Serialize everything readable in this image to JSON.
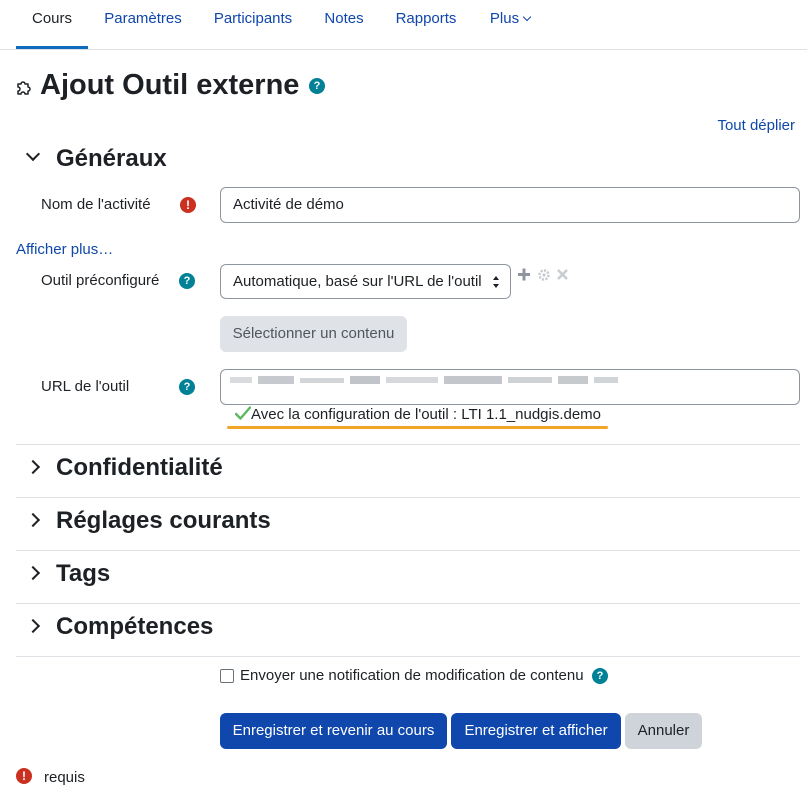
{
  "tabs": [
    {
      "label": "Cours",
      "active": true
    },
    {
      "label": "Paramètres"
    },
    {
      "label": "Participants"
    },
    {
      "label": "Notes"
    },
    {
      "label": "Rapports"
    },
    {
      "label": "Plus"
    }
  ],
  "header": {
    "icon": "puzzle-icon",
    "title": "Ajout Outil externe",
    "help_glyph": "?",
    "expand_all": "Tout déplier"
  },
  "general": {
    "title": "Généraux",
    "activity_name_label": "Nom de l'activité",
    "activity_name_value": "Activité de démo",
    "required_glyph": "!",
    "show_more": "Afficher plus…",
    "preconfigured_label": "Outil préconfiguré",
    "preconfigured_value": "Automatique, basé sur l'URL de l'outil",
    "select_content_button": "Sélectionner un contenu",
    "tool_url_label": "URL de l'outil",
    "tool_config_text": "Avec la configuration de l'outil : LTI 1.1_nudgis.demo",
    "tool_icons": [
      "plus-icon",
      "gear-icon",
      "close-icon"
    ]
  },
  "sections": [
    {
      "title": "Confidentialité"
    },
    {
      "title": "Réglages courants"
    },
    {
      "title": "Tags"
    },
    {
      "title": "Compétences"
    }
  ],
  "notification": {
    "label": "Envoyer une notification de modification de contenu",
    "checked": false
  },
  "actions": {
    "save_return": "Enregistrer et revenir au cours",
    "save_display": "Enregistrer et afficher",
    "cancel": "Annuler"
  },
  "footer": {
    "required_note": "requis"
  },
  "colors": {
    "primary": "#0f47ad",
    "help": "#008196",
    "required": "#ca3120",
    "highlight": "#f2a527",
    "check": "#5cb85c"
  }
}
